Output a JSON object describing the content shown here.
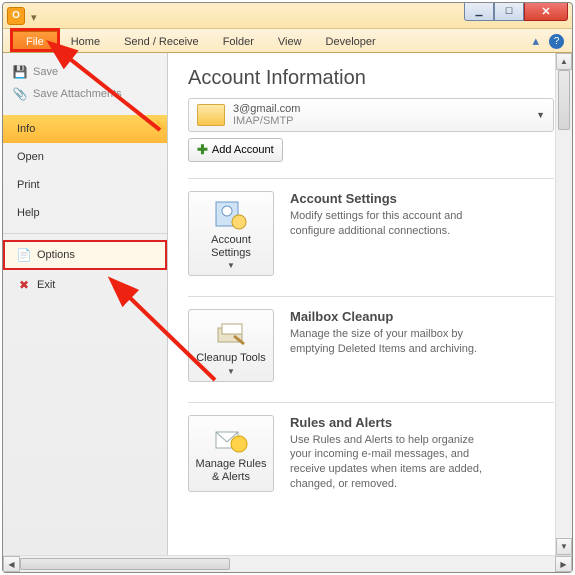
{
  "titlebar": {
    "app_letter": "O"
  },
  "window_controls": {
    "min": "▁",
    "max": "☐",
    "close": "✕"
  },
  "tabs": {
    "file": "File",
    "items": [
      "Home",
      "Send / Receive",
      "Folder",
      "View",
      "Developer"
    ]
  },
  "help": {
    "up": "▴",
    "q": "?"
  },
  "sidebar": {
    "save": "Save",
    "save_attachments": "Save Attachments",
    "nav": [
      "Info",
      "Open",
      "Print",
      "Help"
    ],
    "options": "Options",
    "exit": "Exit"
  },
  "main": {
    "title": "Account Information",
    "account": {
      "email": "3@gmail.com",
      "protocol": "IMAP/SMTP"
    },
    "add_account": "Add Account",
    "sections": [
      {
        "btn": "Account Settings",
        "heading": "Account Settings",
        "desc": "Modify settings for this account and configure additional connections."
      },
      {
        "btn": "Cleanup Tools",
        "heading": "Mailbox Cleanup",
        "desc": "Manage the size of your mailbox by emptying Deleted Items and archiving."
      },
      {
        "btn": "Manage Rules & Alerts",
        "heading": "Rules and Alerts",
        "desc": "Use Rules and Alerts to help organize your incoming e-mail messages, and receive updates when items are added, changed, or removed."
      }
    ]
  }
}
